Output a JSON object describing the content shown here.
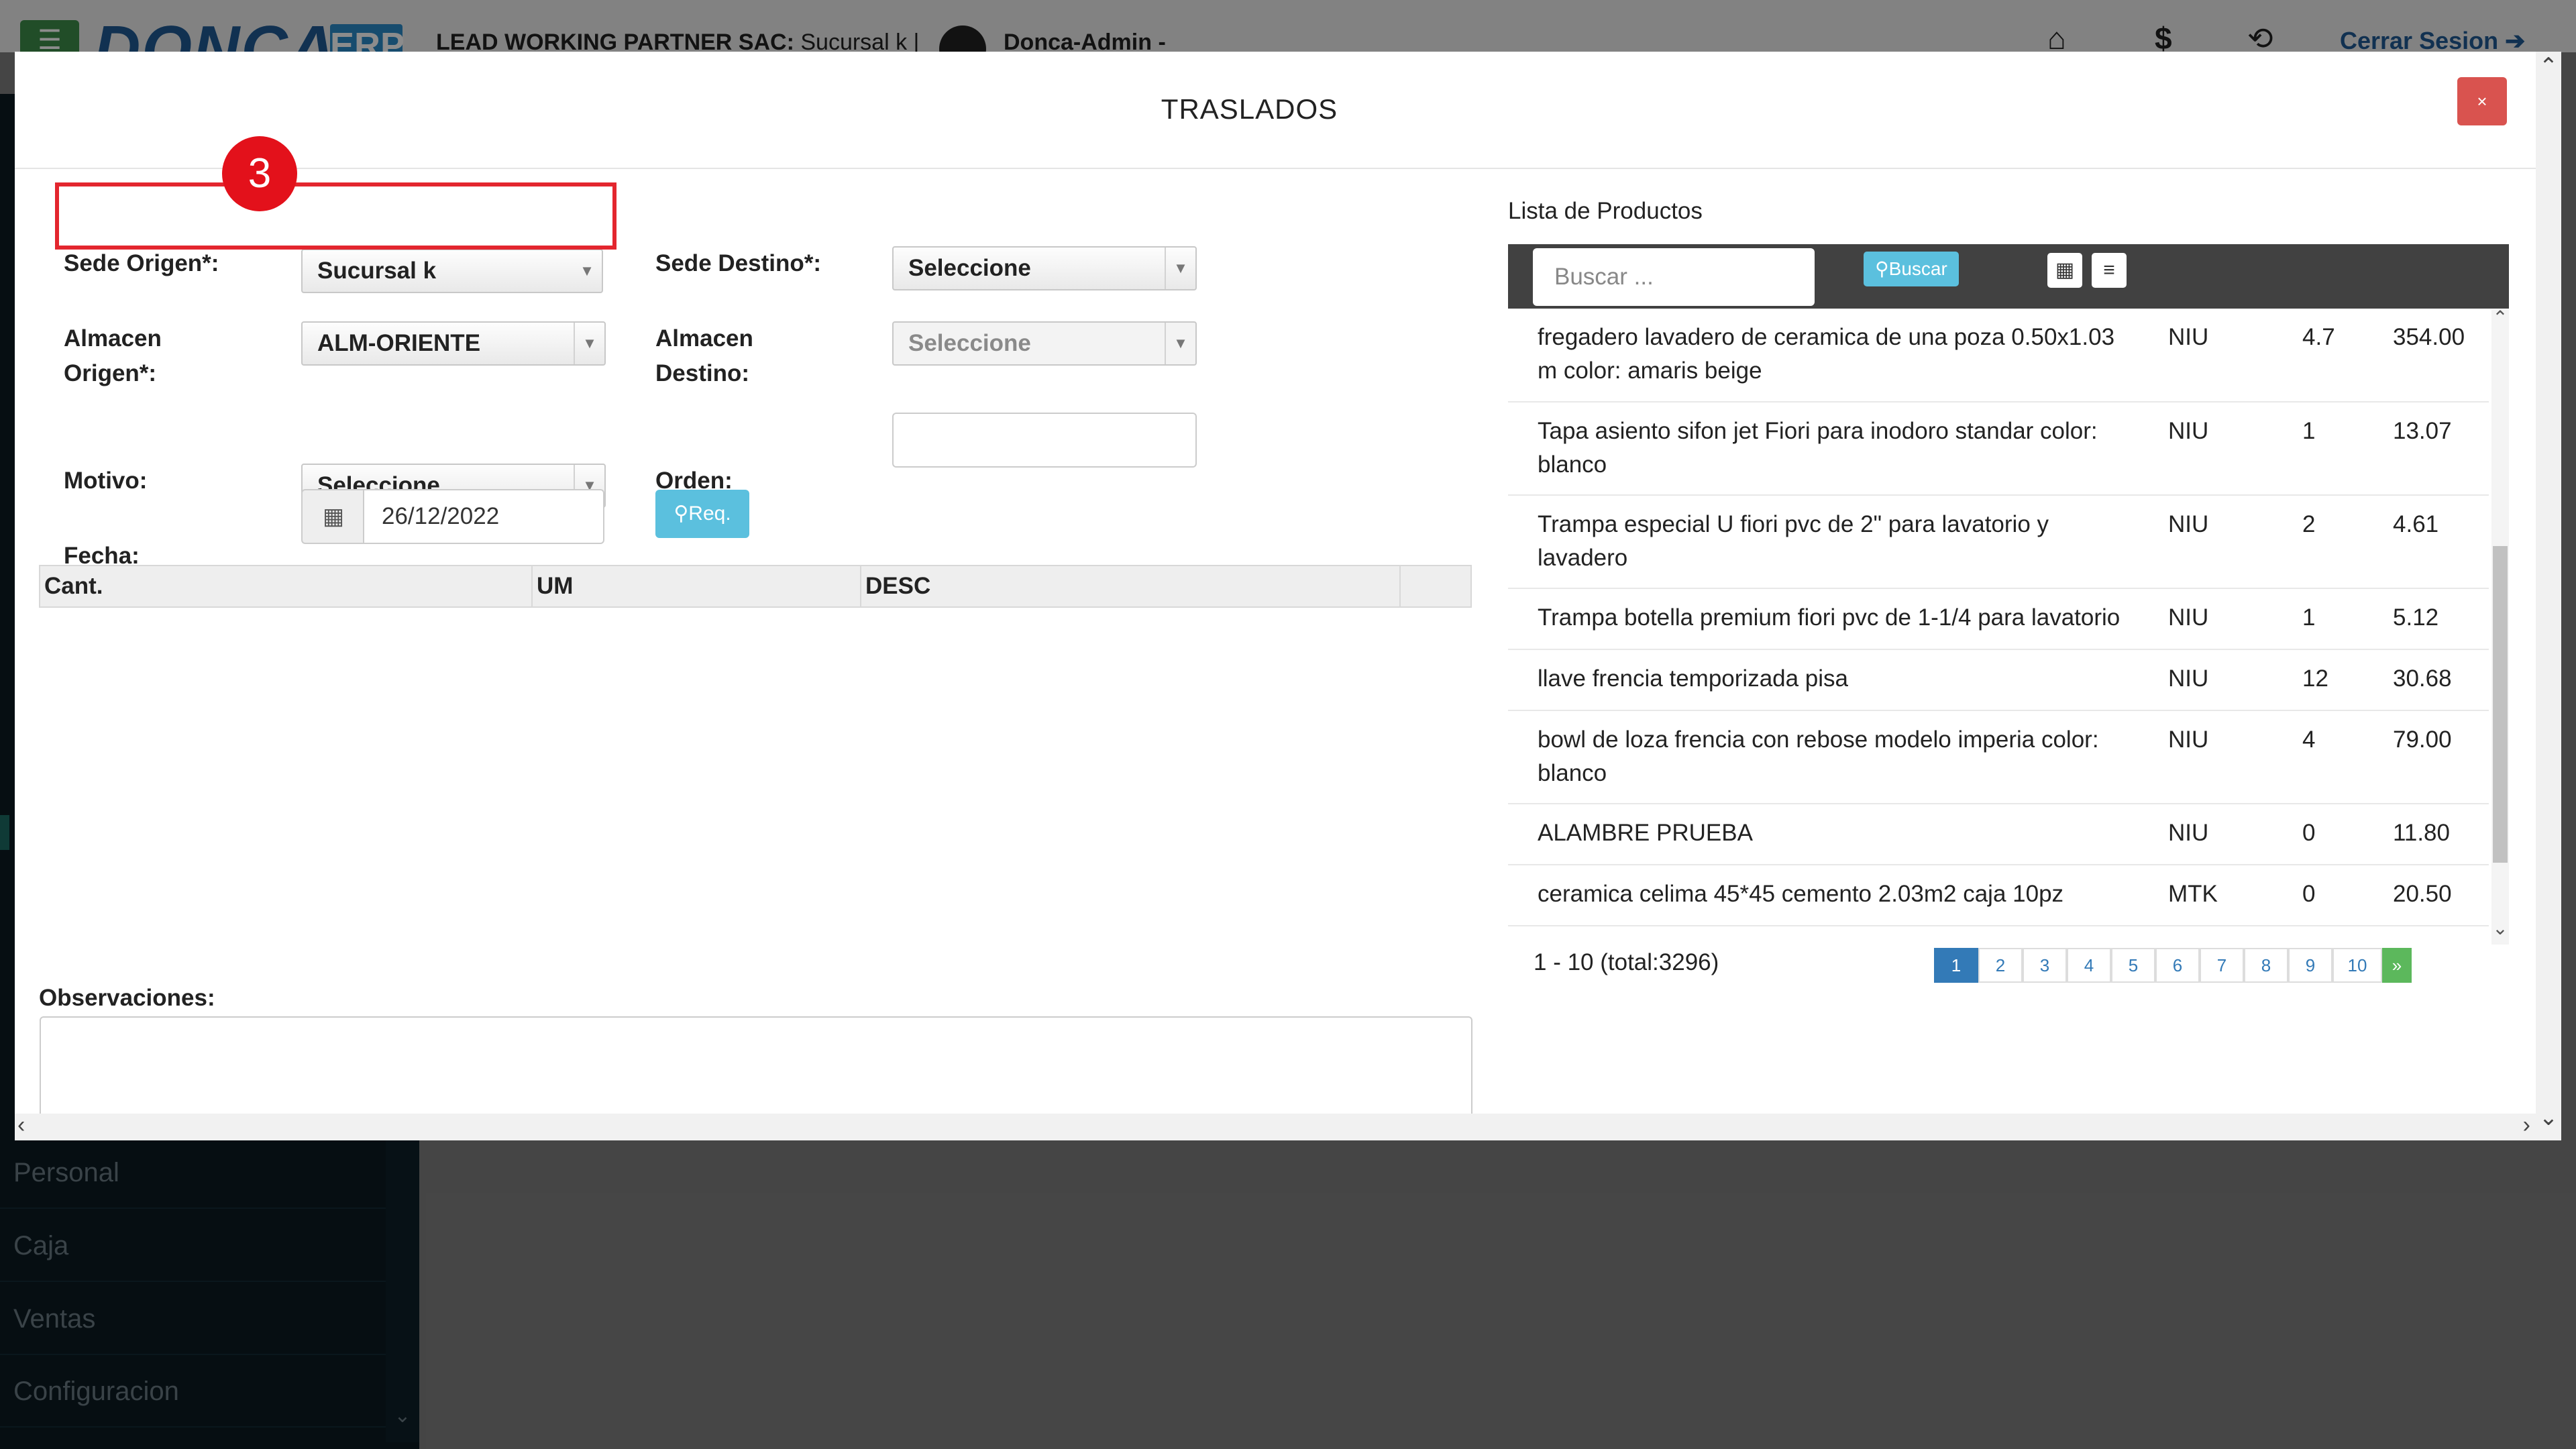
{
  "app": {
    "logo_text": "DONCA",
    "logo_badge": "ERP",
    "company_bold": "LEAD WORKING PARTNER SAC:",
    "company_branch": "Sucursal k |",
    "user": "Donca-Admin -",
    "logout": "Cerrar Sesion"
  },
  "sidebar": {
    "items": [
      {
        "label": "Personal"
      },
      {
        "label": "Caja"
      },
      {
        "label": "Ventas"
      },
      {
        "label": "Configuracion"
      }
    ]
  },
  "modal": {
    "title": "TRASLADOS",
    "close": "×",
    "step_badge": "3",
    "sede_origen": {
      "label": "Sede Origen*:",
      "value": "Sucursal k"
    },
    "sede_destino": {
      "label": "Sede Destino*:",
      "value": "Seleccione"
    },
    "almacen_origen": {
      "label_line1": "Almacen",
      "label_line2": "Origen*:",
      "value": "ALM-ORIENTE"
    },
    "almacen_destino": {
      "label_line1": "Almacen",
      "label_line2": "Destino:",
      "value": "Seleccione"
    },
    "motivo": {
      "label": "Motivo:",
      "value": "Seleccione"
    },
    "orden": {
      "label": "Orden:",
      "value": ""
    },
    "fecha": {
      "label": "Fecha:",
      "value": "26/12/2022"
    },
    "req_button": "Req.",
    "grid_columns": [
      "Cant.",
      "UM",
      "DESC",
      ""
    ],
    "observaciones_label": "Observaciones:"
  },
  "productos": {
    "title": "Lista de Productos",
    "search_placeholder": "Buscar ...",
    "search_button": "Buscar",
    "rows": [
      {
        "desc": "fregadero lavadero de ceramica de una poza 0.50x1.03 m color: amaris beige",
        "um": "NIU",
        "qty": "4.7",
        "price": "354.00"
      },
      {
        "desc": "Tapa asiento sifon jet Fiori para inodoro standar color: blanco",
        "um": "NIU",
        "qty": "1",
        "price": "13.07"
      },
      {
        "desc": "Trampa especial U fiori pvc de 2\" para lavatorio y lavadero",
        "um": "NIU",
        "qty": "2",
        "price": "4.61"
      },
      {
        "desc": "Trampa botella premium fiori pvc de 1-1/4 para lavatorio",
        "um": "NIU",
        "qty": "1",
        "price": "5.12"
      },
      {
        "desc": "llave frencia temporizada pisa",
        "um": "NIU",
        "qty": "12",
        "price": "30.68"
      },
      {
        "desc": "bowl de loza frencia con rebose modelo imperia color: blanco",
        "um": "NIU",
        "qty": "4",
        "price": "79.00"
      },
      {
        "desc": "ALAMBRE PRUEBA",
        "um": "NIU",
        "qty": "0",
        "price": "11.80"
      },
      {
        "desc": "ceramica celima 45*45 cemento 2.03m2 caja 10pz",
        "um": "MTK",
        "qty": "0",
        "price": "20.50"
      }
    ],
    "pagination_summary": "1 - 10 (total:3296)",
    "pages": [
      "1",
      "2",
      "3",
      "4",
      "5",
      "6",
      "7",
      "8",
      "9",
      "10"
    ],
    "next_label": "»",
    "active_page": "1"
  }
}
